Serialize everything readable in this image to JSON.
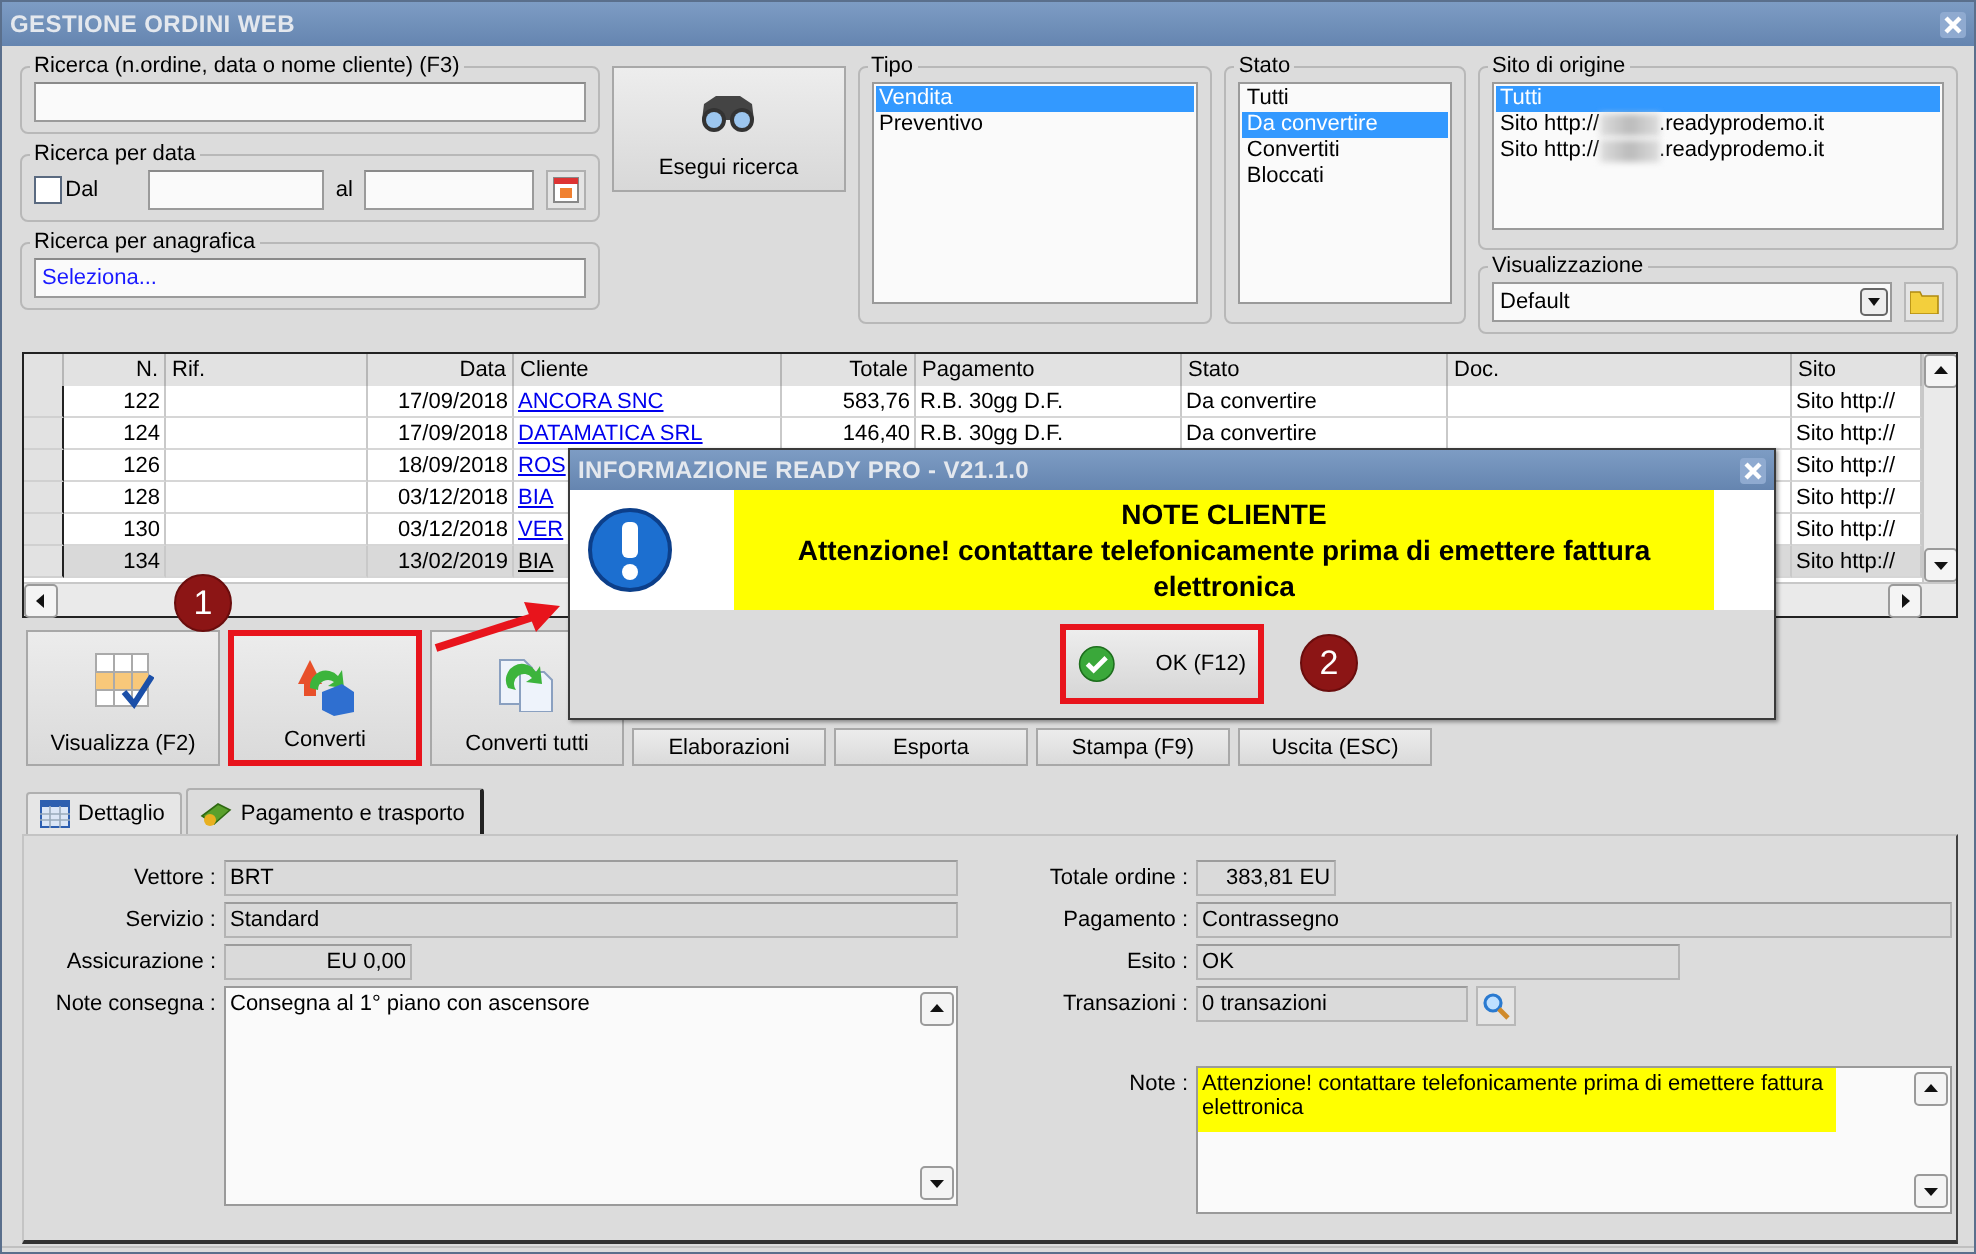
{
  "window": {
    "title": "GESTIONE ORDINI WEB"
  },
  "search": {
    "label": "Ricerca (n.ordine, data o nome cliente) (F3)"
  },
  "date_search": {
    "label": "Ricerca per data",
    "from_label": "Dal",
    "checked": false,
    "to_label": "al"
  },
  "registry_search": {
    "label": "Ricerca per anagrafica",
    "value": "Seleziona..."
  },
  "search_button": {
    "label": "Esegui ricerca"
  },
  "tipo": {
    "label": "Tipo",
    "items": [
      {
        "label": "Vendita",
        "selected": true
      },
      {
        "label": "Preventivo",
        "selected": false
      }
    ]
  },
  "stato": {
    "label": "Stato",
    "items": [
      {
        "label": "Tutti",
        "selected": false
      },
      {
        "label": "Da convertire",
        "selected": true
      },
      {
        "label": "Convertiti",
        "selected": false
      },
      {
        "label": "Bloccati",
        "selected": false
      }
    ]
  },
  "sito_origine": {
    "label": "Sito di origine",
    "items": [
      {
        "label": "Tutti",
        "selected": true
      },
      {
        "label": "Sito http://",
        "suffix": ".readyprodemo.it",
        "redacted": true,
        "selected": false
      },
      {
        "label": "Sito http://",
        "suffix": ".readyprodemo.it",
        "redacted": true,
        "selected": false
      }
    ]
  },
  "visualizzazione": {
    "label": "Visualizzazione",
    "value": "Default"
  },
  "table": {
    "columns": [
      "N.",
      "Rif.",
      "Data",
      "Cliente",
      "Totale",
      "Pagamento",
      "Stato",
      "Doc.",
      "Sito"
    ],
    "rows": [
      {
        "cells": [
          "122",
          null,
          "17/09/2018",
          "ANCORA SNC",
          "583,76",
          "R.B. 30gg D.F.",
          "Da convertire",
          null,
          "Sito http://"
        ],
        "selected": false
      },
      {
        "cells": [
          "124",
          null,
          "17/09/2018",
          "DATAMATICA SRL",
          "146,40",
          "R.B. 30gg D.F.",
          "Da convertire",
          null,
          "Sito http://"
        ],
        "selected": false
      },
      {
        "cells": [
          "126",
          null,
          "18/09/2018",
          "ROS",
          null,
          null,
          null,
          null,
          "Sito http://"
        ],
        "selected": false
      },
      {
        "cells": [
          "128",
          null,
          "03/12/2018",
          "BIA",
          null,
          null,
          null,
          null,
          "Sito http://"
        ],
        "selected": false
      },
      {
        "cells": [
          "130",
          null,
          "03/12/2018",
          "VER",
          null,
          null,
          null,
          null,
          "Sito http://"
        ],
        "selected": false
      },
      {
        "cells": [
          "134",
          null,
          "13/02/2019",
          "BIA",
          null,
          null,
          null,
          null,
          "Sito http://"
        ],
        "selected": true
      }
    ]
  },
  "actions": [
    {
      "label": "Visualizza (F2)",
      "kind": "large",
      "highlighted": false
    },
    {
      "label": "Converti",
      "kind": "large",
      "highlighted": true,
      "badge": "1"
    },
    {
      "label": "Converti tutti",
      "kind": "large",
      "highlighted": false
    },
    {
      "label": "Elaborazioni",
      "kind": "small",
      "highlighted": false
    },
    {
      "label": "Esporta",
      "kind": "small",
      "highlighted": false
    },
    {
      "label": "Stampa (F9)",
      "kind": "small",
      "highlighted": false
    },
    {
      "label": "Uscita (ESC)",
      "kind": "small",
      "highlighted": false
    }
  ],
  "tabs": [
    {
      "label": "Dettaglio",
      "selected": false
    },
    {
      "label": "Pagamento e trasporto",
      "selected": true
    }
  ],
  "left_fields": [
    {
      "label": "Vettore :",
      "value": "BRT",
      "kind": "wide"
    },
    {
      "label": "Servizio :",
      "value": "Standard",
      "kind": "wide"
    },
    {
      "label": "Assicurazione :",
      "value": "EU 0,00",
      "kind": "amount"
    },
    {
      "label": "Note consegna :",
      "value": "Consegna al 1° piano con ascensore",
      "kind": "memo"
    }
  ],
  "right_fields": [
    {
      "label": "Totale ordine :",
      "value": "383,81 EU",
      "kind": "amount"
    },
    {
      "label": "Pagamento :",
      "value": "Contrassegno",
      "kind": "wide"
    },
    {
      "label": "Esito :",
      "value": "OK",
      "kind": "medium"
    },
    {
      "label": "Transazioni :",
      "value": "0 transazioni",
      "kind": "lookup"
    },
    {
      "label": "Note :",
      "value": "Attenzione! contattare telefonicamente prima di emettere fattura elettronica",
      "kind": "memo",
      "highlighted": true
    }
  ],
  "dialog": {
    "title": "INFORMAZIONE READY PRO - V21.1.0",
    "heading": "NOTE CLIENTE",
    "message": "Attenzione! contattare telefonicamente prima di emettere fattura elettronica",
    "ok": {
      "label": "OK (F12)",
      "highlighted": true,
      "badge": "2"
    }
  }
}
